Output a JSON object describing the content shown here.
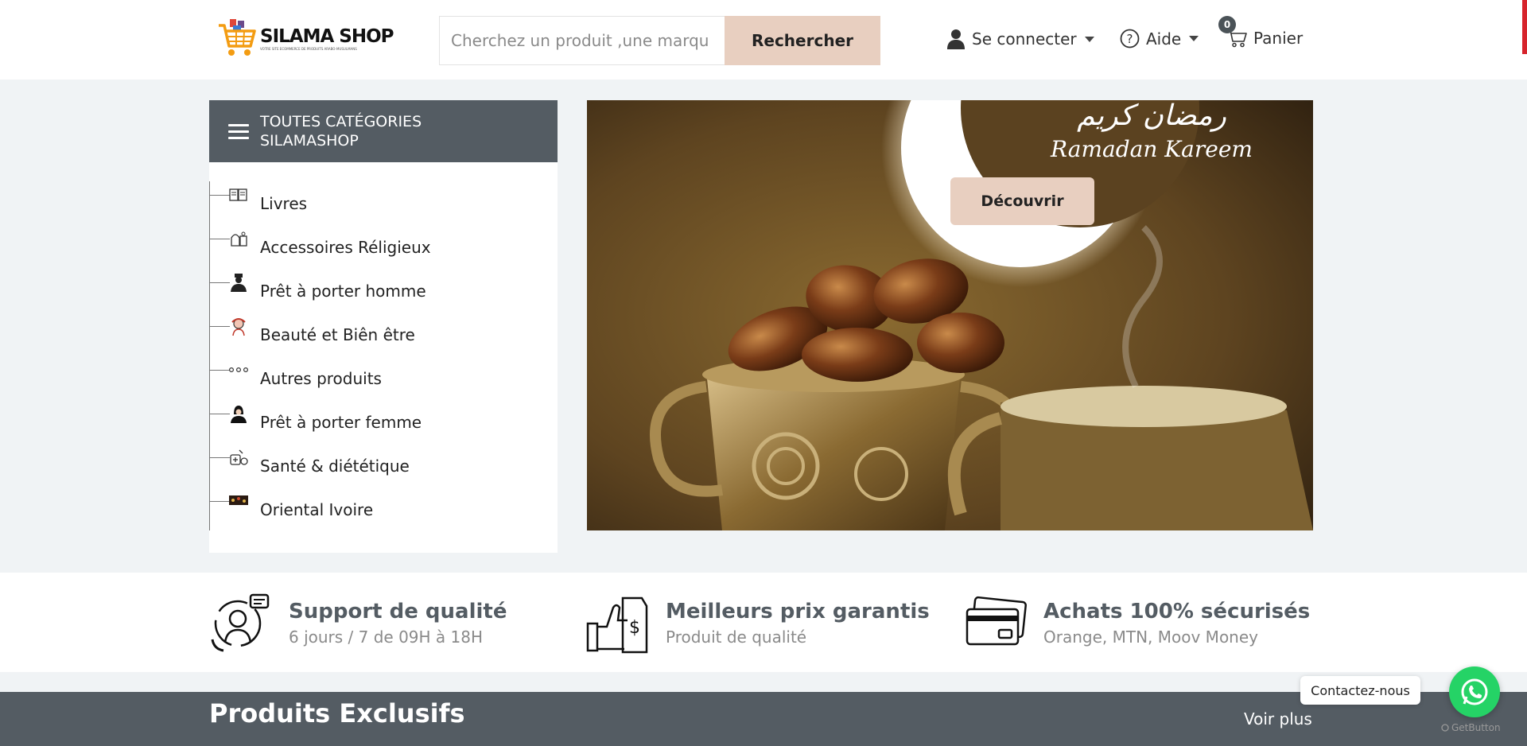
{
  "header": {
    "logo": {
      "name": "SILAMA SHOP",
      "tagline": "VOTRE SITE ECOMMERCE DE PRODUITS ARABO-MUSULMANS"
    },
    "search": {
      "placeholder": "Cherchez un produit ,une marqu",
      "button_label": "Rechercher"
    },
    "nav": {
      "login_label": "Se connecter",
      "help_label": "Aide",
      "cart_label": "Panier",
      "cart_count": "0"
    }
  },
  "categories": {
    "title_line1": "TOUTES CATÉGORIES",
    "title_line2": "SILAMASHOP",
    "items": [
      {
        "label": "Livres",
        "icon": "books-icon"
      },
      {
        "label": "Accessoires Réligieux",
        "icon": "religious-accessories-icon"
      },
      {
        "label": "Prêt à porter homme",
        "icon": "man-icon"
      },
      {
        "label": "Beauté et Biên être",
        "icon": "beauty-icon"
      },
      {
        "label": "Autres produits",
        "icon": "dots-icon"
      },
      {
        "label": "Prêt à porter femme",
        "icon": "woman-icon"
      },
      {
        "label": "Santé & diététique",
        "icon": "health-icon"
      },
      {
        "label": "Oriental Ivoire",
        "icon": "oriental-icon"
      }
    ]
  },
  "banner": {
    "arabic_text": "رمضان كريم",
    "title": "Ramadan Kareem",
    "button_label": "Découvrir"
  },
  "features": [
    {
      "title": "Support de qualité",
      "subtitle": "6 jours / 7 de 09H à 18H",
      "icon": "support-agent-icon"
    },
    {
      "title": "Meilleurs prix garantis",
      "subtitle": "Produit de qualité",
      "icon": "thumbs-up-price-icon"
    },
    {
      "title": "Achats 100% sécurisés",
      "subtitle": "Orange, MTN, Moov Money",
      "icon": "credit-card-icon"
    }
  ],
  "exclusive": {
    "title": "Produits Exclusifs",
    "more_label": "Voir plus"
  },
  "whatsapp": {
    "contact_label": "Contactez-nous",
    "provider_label": "GetButton"
  },
  "colors": {
    "accent": "#e8cfc0",
    "dark": "#545c63",
    "whatsapp": "#25d366",
    "background": "#f0f3f5"
  }
}
